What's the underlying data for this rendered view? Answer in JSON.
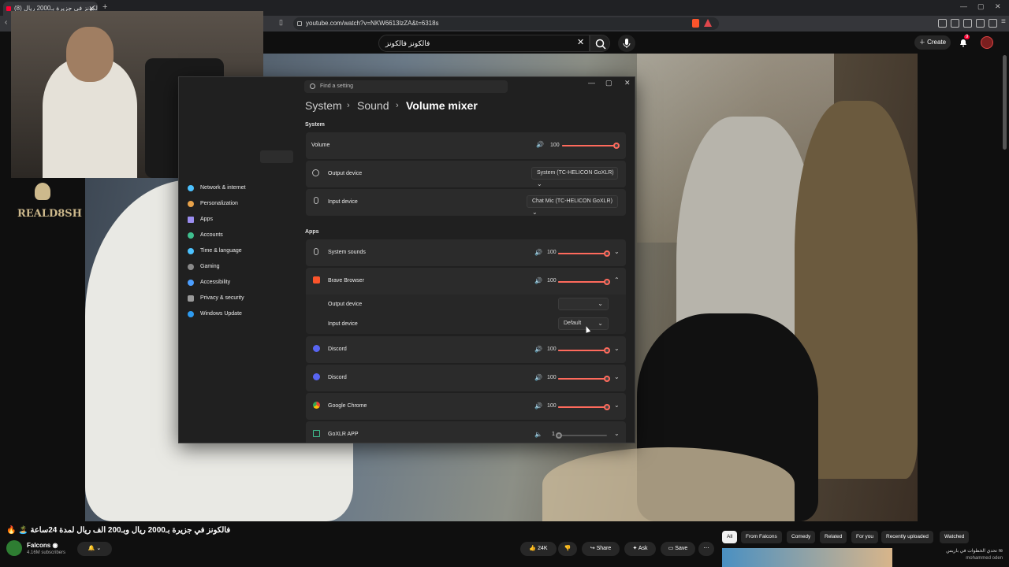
{
  "browser": {
    "tab_title": "(8) فالكونز في جزيرة بـ2000 ريال",
    "new_tab": "+",
    "url": "youtube.com/watch?v=NKW6613lzZA&t=6318s"
  },
  "youtube": {
    "search_value": "فالكونز فالكونز",
    "create_label": "Create",
    "notif_count": "9"
  },
  "overlay": {
    "logo_text": "REALD8SH"
  },
  "settings": {
    "search_placeholder": "Find a setting",
    "breadcrumb": [
      "System",
      "Sound",
      "Volume mixer"
    ],
    "nav": [
      {
        "label": "Network & internet",
        "color": "#4cc2ff"
      },
      {
        "label": "Personalization",
        "color": "#e8a24a"
      },
      {
        "label": "Apps",
        "color": "#9b8df0"
      },
      {
        "label": "Accounts",
        "color": "#3fbf8f"
      },
      {
        "label": "Time & language",
        "color": "#4cc2ff"
      },
      {
        "label": "Gaming",
        "color": "#8a8a8a"
      },
      {
        "label": "Accessibility",
        "color": "#4c9fff"
      },
      {
        "label": "Privacy & security",
        "color": "#9a9a9a"
      },
      {
        "label": "Windows Update",
        "color": "#2e9bf0"
      }
    ],
    "system_section": "System",
    "volume_label": "Volume",
    "volume_value": "100",
    "output_device_label": "Output device",
    "output_device_value": "System (TC-HELICON GoXLR)",
    "input_device_label": "Input device",
    "input_device_value": "Chat Mic (TC-HELICON GoXLR)",
    "apps_section": "Apps",
    "apps": [
      {
        "name": "System sounds",
        "value": "100",
        "level": 1.0
      },
      {
        "name": "Brave Browser",
        "value": "100",
        "level": 1.0
      },
      {
        "name": "Discord",
        "value": "100",
        "level": 1.0
      },
      {
        "name": "Discord",
        "value": "100",
        "level": 1.0
      },
      {
        "name": "Google Chrome",
        "value": "100",
        "level": 1.0
      },
      {
        "name": "GoXLR APP",
        "value": "1",
        "level": 0.01
      }
    ],
    "brave_output_label": "Output device",
    "brave_output_value": "",
    "brave_input_label": "Input device",
    "brave_input_value": "Default"
  },
  "video": {
    "title": "🔥 🏝️ فالكونز في جزيرة بـ2000 ريال وبـ200 الف ريال لمدة 24ساعة",
    "channel": "Falcons",
    "subscribers": "4.16M subscribers",
    "likes": "24K",
    "share": "Share",
    "ask": "Ask",
    "save": "Save"
  },
  "chips": [
    "All",
    "From Falcons",
    "Comedy",
    "Related",
    "For you",
    "Recently uploaded",
    "Watched"
  ],
  "related": {
    "title": "تحدي الخطوات في باريس re",
    "channel": "mohammed oden"
  },
  "colors": {
    "accent": "#ff6a5c",
    "youtube_red": "#ff0033"
  }
}
